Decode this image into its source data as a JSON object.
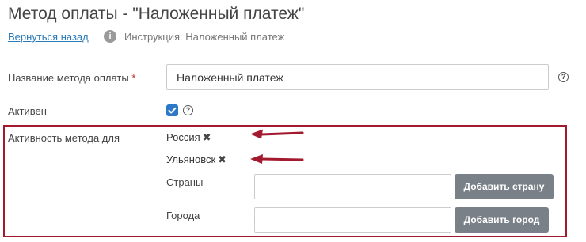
{
  "header": {
    "title": "Метод оплаты - \"Наложенный платеж\"",
    "back_link": "Вернуться назад",
    "info_icon_glyph": "i",
    "info_text": "Инструкция. Наложенный платеж"
  },
  "form": {
    "name": {
      "label": "Название метода оплаты",
      "required_mark": "*",
      "value": "Наложенный платеж",
      "help_glyph": "?"
    },
    "active": {
      "label": "Активен",
      "checked": true,
      "help_glyph": "?"
    },
    "activity": {
      "label": "Активность метода для",
      "tags": [
        {
          "text": "Россия",
          "remove_glyph": "✖"
        },
        {
          "text": "Ульяновск",
          "remove_glyph": "✖"
        }
      ],
      "countries": {
        "label": "Страны",
        "value": "",
        "button": "Добавить страну"
      },
      "cities": {
        "label": "Города",
        "value": "",
        "button": "Добавить город"
      }
    }
  },
  "colors": {
    "highlight_border": "#a31a2e",
    "arrow": "#a31a2e",
    "link": "#2a7ab8",
    "checkbox": "#2e79c7",
    "button": "#7a8088"
  },
  "icons": {
    "info": "info-circle-icon",
    "help": "question-circle-icon",
    "remove": "close-icon",
    "arrow": "arrow-left-icon"
  }
}
